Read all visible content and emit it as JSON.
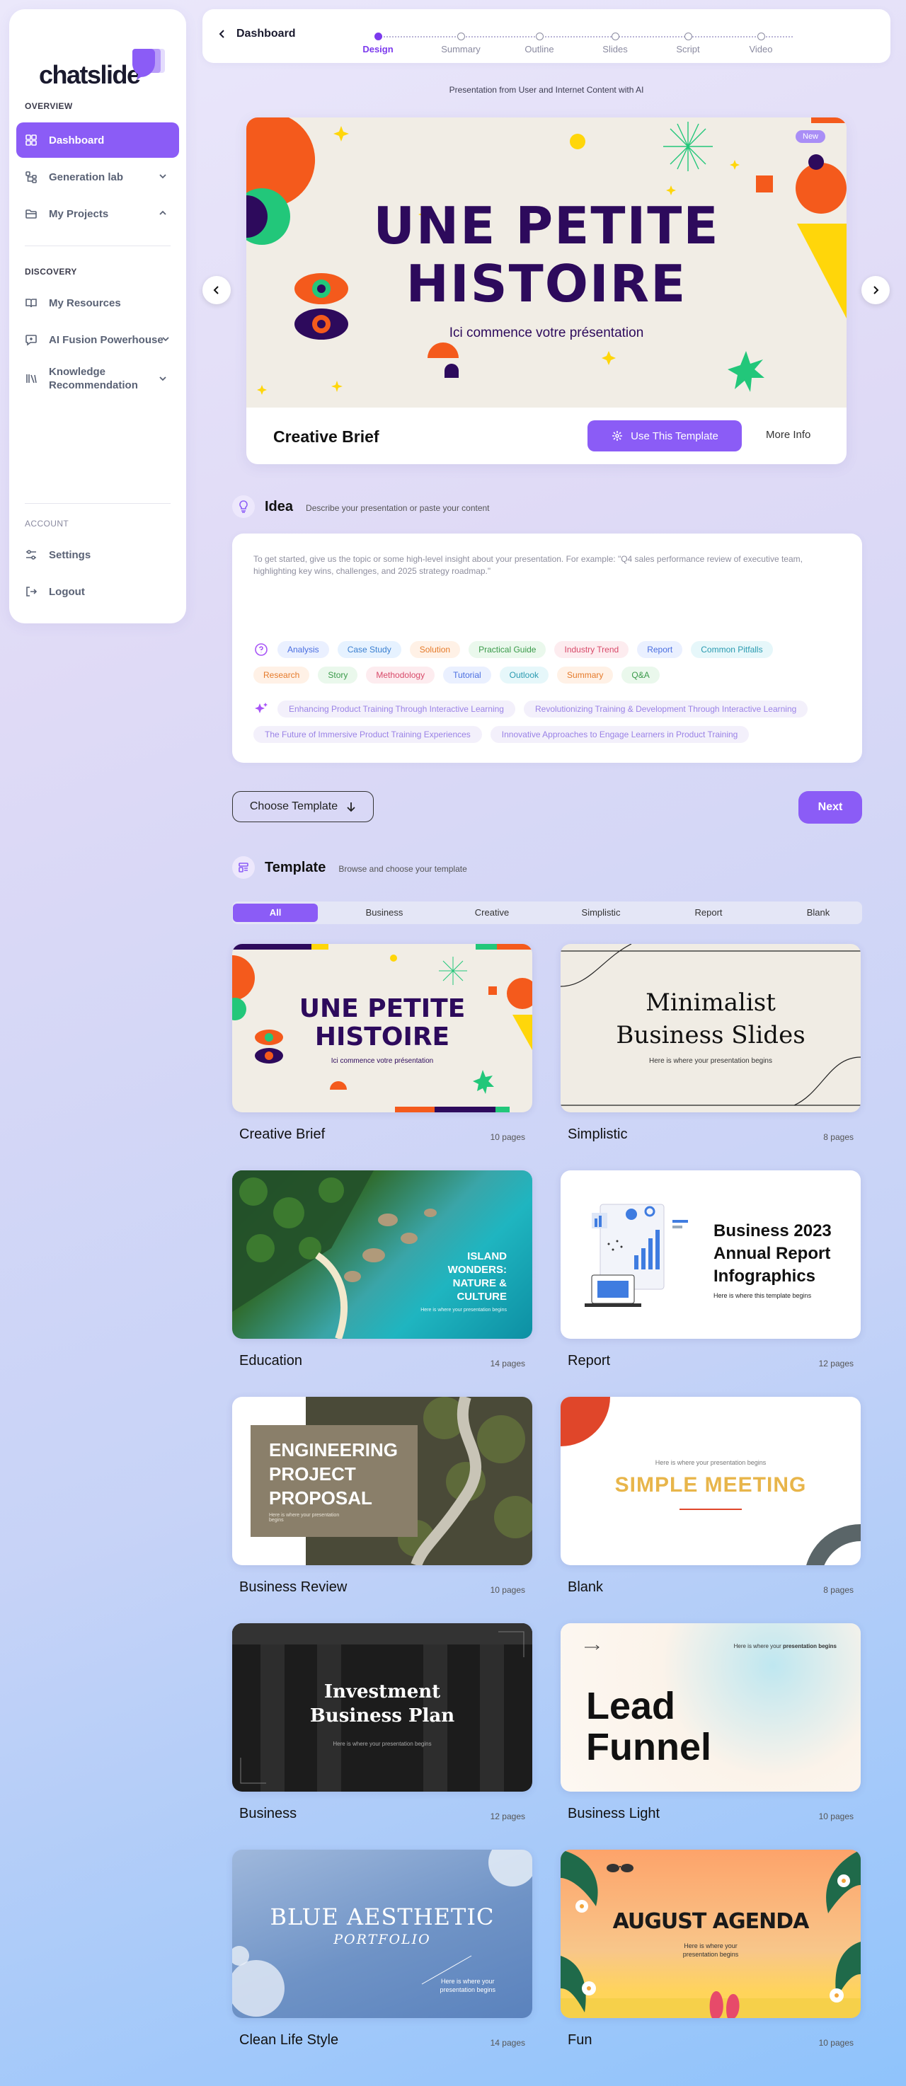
{
  "brand": {
    "logo": "chatslide"
  },
  "sidebar": {
    "overview_label": "OVERVIEW",
    "discovery_label": "DISCOVERY",
    "account_label": "ACCOUNT",
    "items": {
      "dashboard": "Dashboard",
      "generation": "Generation lab",
      "projects": "My Projects",
      "resources": "My Resources",
      "fusion": "AI Fusion Powerhouse",
      "knowledge": "Knowledge Recommendation",
      "settings": "Settings",
      "logout": "Logout"
    }
  },
  "topbar": {
    "back_label": "Dashboard",
    "steps": [
      "Design",
      "Summary",
      "Outline",
      "Slides",
      "Script",
      "Video"
    ],
    "active_step": "Design"
  },
  "subtitle": "Presentation from User and Internet Content with AI",
  "hero": {
    "badge": "New",
    "title_line1": "une petite",
    "title_line2": "histoire",
    "tagline": "Ici commence votre présentation",
    "name": "Creative Brief",
    "use_label": "Use This Template",
    "more_label": "More Info"
  },
  "idea": {
    "title": "Idea",
    "desc": "Describe your presentation or paste your content",
    "placeholder": "To get started, give us the topic or some high-level insight about your presentation. For example: \"Q4 sales performance review of executive team, highlighting key wins, challenges, and 2025 strategy roadmap.\"",
    "chips_row1": [
      "Analysis",
      "Case Study",
      "Solution",
      "Practical Guide",
      "Industry Trend",
      "Report",
      "Common Pitfalls"
    ],
    "chips_row2": [
      "Research",
      "Story",
      "Methodology",
      "Tutorial",
      "Outlook",
      "Summary",
      "Q&A"
    ],
    "suggestions_row1": [
      "Enhancing Product Training Through Interactive Learning",
      "Revolutionizing Training & Development Through Interactive Learning"
    ],
    "suggestions_row2": [
      "The Future of Immersive Product Training Experiences",
      "Innovative Approaches to Engage Learners in Product Training"
    ]
  },
  "actions": {
    "choose_label": "Choose Template",
    "next_label": "Next"
  },
  "templates": {
    "title": "Template",
    "desc": "Browse and choose your template",
    "tabs": [
      "All",
      "Business",
      "Creative",
      "Simplistic",
      "Report",
      "Blank"
    ],
    "active_tab": "All",
    "cards": [
      {
        "name": "Creative Brief",
        "pages": "10 pages",
        "t1": "une petite",
        "t2": "histoire",
        "t3": "Ici commence votre présentation"
      },
      {
        "name": "Simplistic",
        "pages": "8 pages",
        "t1": "Minimalist",
        "t2": "Business Slides",
        "t3": "Here is where your presentation begins"
      },
      {
        "name": "Education",
        "pages": "14 pages",
        "t1": "ISLAND",
        "t2": "WONDERS:",
        "t2b": "NATURE &",
        "t2c": "CULTURE",
        "t3": "Here is where your presentation begins"
      },
      {
        "name": "Report",
        "pages": "12 pages",
        "t1": "Business 2023",
        "t2": "Annual Report",
        "t2b": "Infographics",
        "t3": "Here is where this template begins"
      },
      {
        "name": "Business Review",
        "pages": "10 pages",
        "t1": "ENGINEERING",
        "t2": "PROJECT",
        "t2b": "PROPOSAL",
        "t3": "Here is where your presentation begins"
      },
      {
        "name": "Blank",
        "pages": "8 pages",
        "t1": "Here is where your presentation begins",
        "t2": "SIMPLE MEETING"
      },
      {
        "name": "Business",
        "pages": "12 pages",
        "t1": "Investment",
        "t2": "Business Plan",
        "t3": "Here is where your presentation begins"
      },
      {
        "name": "Business Light",
        "pages": "10 pages",
        "t1": "Here is where your",
        "t1b": "presentation begins",
        "t2": "Lead",
        "t2b": "Funnel"
      },
      {
        "name": "Clean Life Style",
        "pages": "14 pages",
        "t1": "BLUE AESTHETIC",
        "t2": "PORTFOLIO",
        "t3": "Here is where your",
        "t3b": "presentation begins"
      },
      {
        "name": "Fun",
        "pages": "10 pages",
        "t1": "AUGUST AGENDA",
        "t2": "Here is where your",
        "t2b": "presentation begins"
      }
    ]
  },
  "colors": {
    "accent": "#8b5cf6",
    "accent_dark": "#7c3aed",
    "hero_title": "#2d0a5c",
    "orange": "#f45a1c",
    "green": "#22c77a"
  }
}
